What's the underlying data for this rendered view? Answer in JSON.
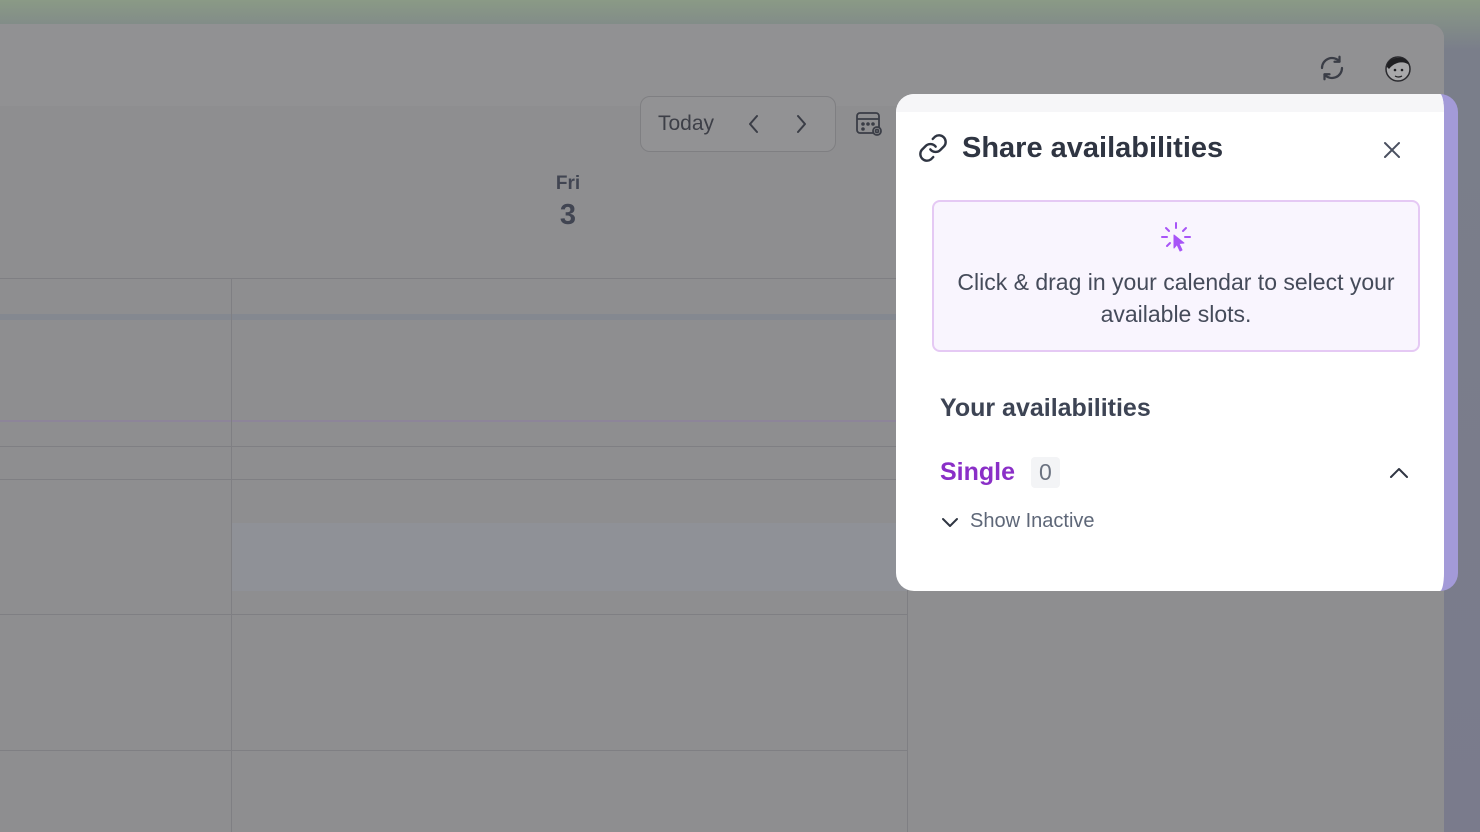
{
  "topbar": {
    "sync_icon": "refresh-icon",
    "avatar_icon": "user-avatar"
  },
  "toolbar": {
    "today_label": "Today",
    "prev_icon": "chevron-left-icon",
    "next_icon": "chevron-right-icon",
    "calendar_settings_icon": "calendar-settings-icon"
  },
  "calendar": {
    "day_name": "Fri",
    "day_number": "3"
  },
  "panel": {
    "title": "Share availabilities",
    "title_icon": "link-icon",
    "close_icon": "close-icon",
    "hint_icon": "cursor-click-icon",
    "hint_text": "Click & drag in your calendar to select your available slots.",
    "section_title": "Your availabilities",
    "group": {
      "label": "Single",
      "count": "0",
      "expanded": true
    },
    "show_inactive_label": "Show Inactive"
  },
  "colors": {
    "accent": "#8a2fc7",
    "hint_bg": "#f9f5fe",
    "hint_border": "#e5c9f4",
    "panel_edge": "#a39ad8"
  }
}
